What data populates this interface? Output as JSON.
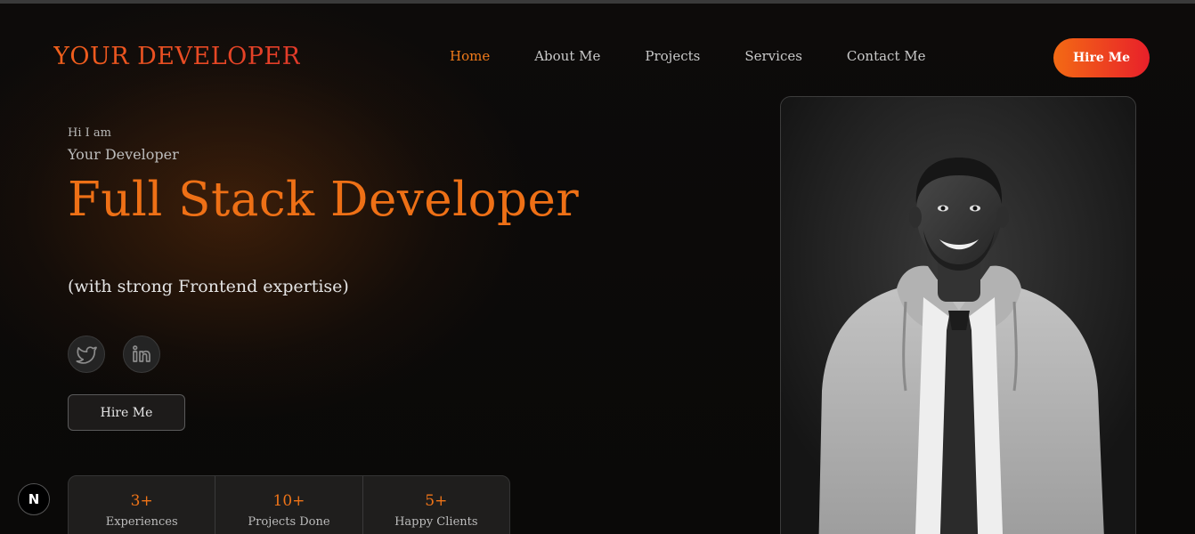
{
  "brand": {
    "logo_text": "YOUR DEVELOPER"
  },
  "nav": {
    "items": [
      {
        "label": "Home",
        "active": true
      },
      {
        "label": "About Me"
      },
      {
        "label": "Projects"
      },
      {
        "label": "Services"
      },
      {
        "label": "Contact Me"
      }
    ],
    "cta_label": "Hire Me"
  },
  "hero": {
    "greeting": "Hi I am",
    "name": "Your Developer",
    "role": "Full Stack Developer",
    "tagline": "(with strong Frontend expertise)",
    "social": [
      {
        "icon": "twitter-icon"
      },
      {
        "icon": "linkedin-icon"
      }
    ],
    "cta_label": "Hire Me"
  },
  "stats": [
    {
      "value": "3+",
      "label": "Experiences"
    },
    {
      "value": "10+",
      "label": "Projects Done"
    },
    {
      "value": "5+",
      "label": "Happy Clients"
    }
  ],
  "colors": {
    "accent": "#ee7016",
    "cta_gradient_start": "#f36a14",
    "cta_gradient_end": "#e8202a",
    "background": "#0a0a0a"
  },
  "dev_badge": {
    "label": "N"
  }
}
